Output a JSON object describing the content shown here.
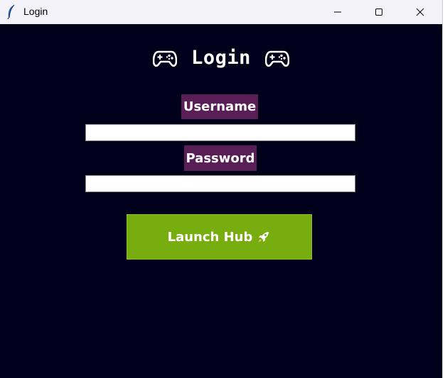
{
  "window": {
    "title": "Login",
    "icon": "feather-icon",
    "controls": [
      "minimize-icon",
      "maximize-icon",
      "close-icon"
    ]
  },
  "heading": {
    "text": "Login",
    "icon": "gamepad-icon"
  },
  "form": {
    "username_label": "Username",
    "username_value": "",
    "password_label": "Password",
    "password_value": ""
  },
  "launch_button": {
    "label": "Launch Hub",
    "icon": "rocket-icon"
  },
  "colors": {
    "background": "#00001a",
    "label_background": "#5a1e56",
    "button_background": "#77ad0e",
    "titlebar": "#f3f2f8"
  }
}
